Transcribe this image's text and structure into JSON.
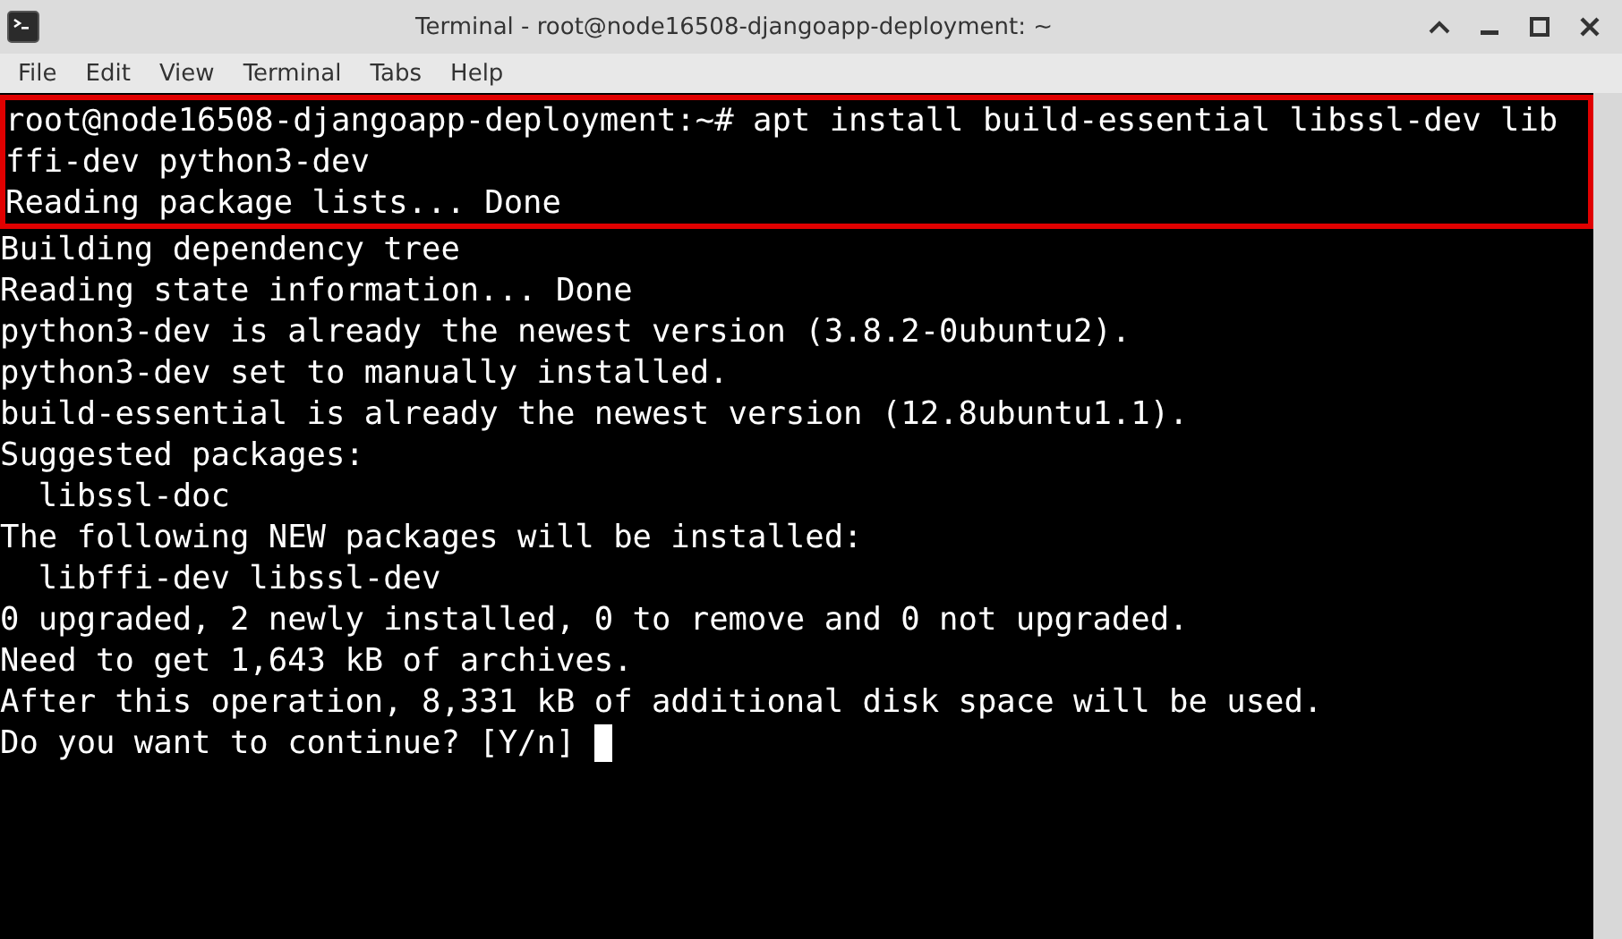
{
  "window": {
    "title": "Terminal - root@node16508-djangoapp-deployment: ~"
  },
  "menu": [
    "File",
    "Edit",
    "View",
    "Terminal",
    "Tabs",
    "Help"
  ],
  "terminal": {
    "lines": [
      {
        "text": "root@node16508-djangoapp-deployment:~# apt install build-essential libssl-dev lib",
        "highlighted": true,
        "cursor": false
      },
      {
        "text": "ffi-dev python3-dev",
        "highlighted": true,
        "cursor": false
      },
      {
        "text": "Reading package lists... Done",
        "highlighted": true,
        "cursor": false
      },
      {
        "text": "Building dependency tree",
        "highlighted": false,
        "cursor": false
      },
      {
        "text": "Reading state information... Done",
        "highlighted": false,
        "cursor": false
      },
      {
        "text": "python3-dev is already the newest version (3.8.2-0ubuntu2).",
        "highlighted": false,
        "cursor": false
      },
      {
        "text": "python3-dev set to manually installed.",
        "highlighted": false,
        "cursor": false
      },
      {
        "text": "build-essential is already the newest version (12.8ubuntu1.1).",
        "highlighted": false,
        "cursor": false
      },
      {
        "text": "Suggested packages:",
        "highlighted": false,
        "cursor": false
      },
      {
        "text": "  libssl-doc",
        "highlighted": false,
        "cursor": false
      },
      {
        "text": "The following NEW packages will be installed:",
        "highlighted": false,
        "cursor": false
      },
      {
        "text": "  libffi-dev libssl-dev",
        "highlighted": false,
        "cursor": false
      },
      {
        "text": "0 upgraded, 2 newly installed, 0 to remove and 0 not upgraded.",
        "highlighted": false,
        "cursor": false
      },
      {
        "text": "Need to get 1,643 kB of archives.",
        "highlighted": false,
        "cursor": false
      },
      {
        "text": "After this operation, 8,331 kB of additional disk space will be used.",
        "highlighted": false,
        "cursor": false
      },
      {
        "text": "Do you want to continue? [Y/n] ",
        "highlighted": false,
        "cursor": true
      }
    ]
  }
}
